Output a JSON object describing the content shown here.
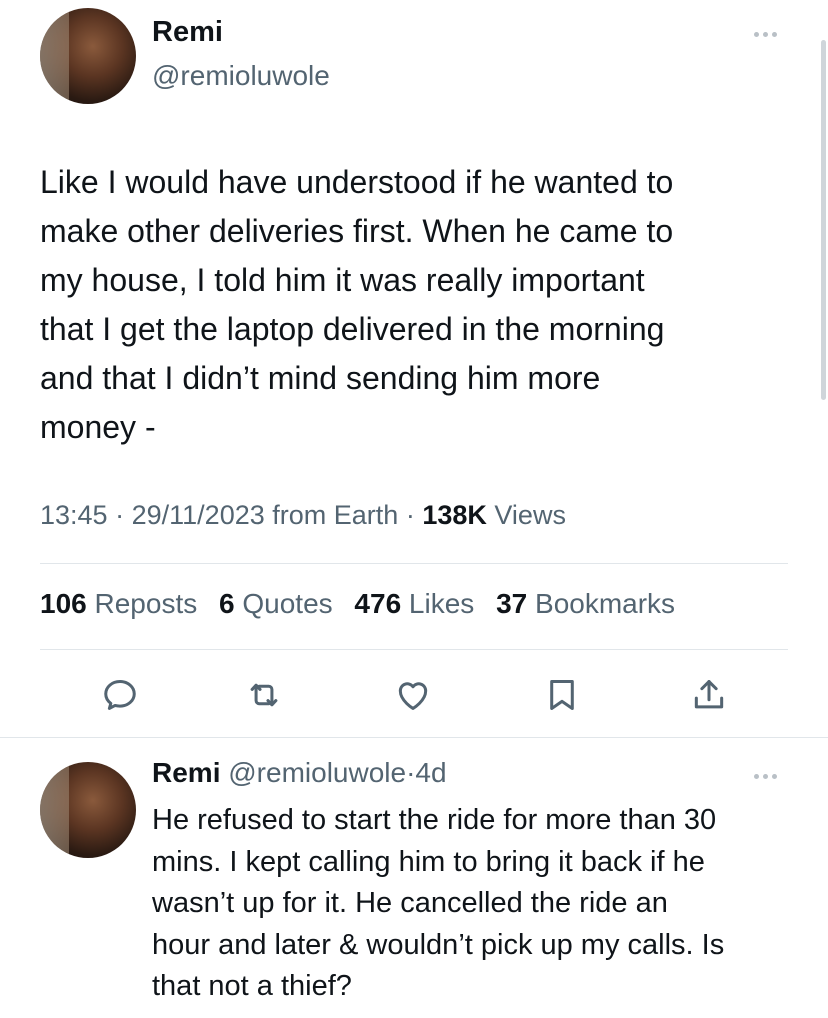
{
  "main_tweet": {
    "author_name": "Remi",
    "author_handle": "@remioluwole",
    "text_lines": [
      "Like I would have understood if he wanted to",
      "make other deliveries first. When he came to",
      "my house, I told him it was really important",
      "that I get the laptop delivered in the morning",
      "and that I didn’t mind sending him more",
      "money -"
    ],
    "time": "13:45",
    "date": "29/11/2023",
    "location": "from Earth",
    "separator": "·",
    "views_count": "138K",
    "views_label": "Views",
    "stats": {
      "reposts_count": "106",
      "reposts_label": "Reposts",
      "quotes_count": "6",
      "quotes_label": "Quotes",
      "likes_count": "476",
      "likes_label": "Likes",
      "bookmarks_count": "37",
      "bookmarks_label": "Bookmarks"
    },
    "actions": [
      "reply-icon",
      "repost-icon",
      "like-icon",
      "bookmark-icon",
      "share-icon"
    ]
  },
  "reply": {
    "author_name": "Remi",
    "author_handle": "@remioluwole",
    "separator": "·",
    "age": "4d",
    "text_lines": [
      "He refused to start the ride for more than 30",
      "mins. I kept calling him to bring it back if he",
      "wasn’t up for it.  He cancelled the ride an",
      "hour and later & wouldn’t pick up my calls. Is",
      "that not a thief?"
    ]
  },
  "colors": {
    "text": "#0f1419",
    "muted": "#536471",
    "divider": "#e1e6ea"
  }
}
